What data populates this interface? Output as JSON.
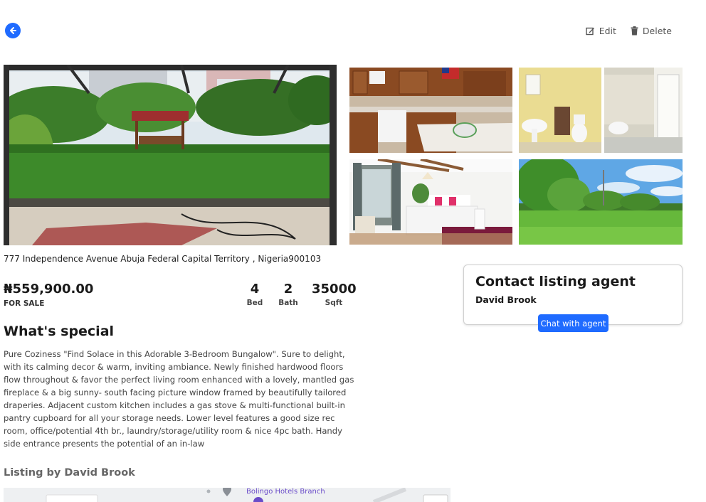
{
  "header": {
    "back_icon": "arrow-left-circle-icon",
    "edit_label": "Edit",
    "edit_icon": "edit-icon",
    "delete_label": "Delete",
    "delete_icon": "trash-icon"
  },
  "gallery": {
    "photos": [
      {
        "subject": "garden-lawn-gazebo"
      },
      {
        "subject": "kitchen"
      },
      {
        "subject": "bathroom"
      },
      {
        "subject": "bedroom"
      },
      {
        "subject": "park-lawn"
      }
    ]
  },
  "listing": {
    "address": "777 Independence Avenue Abuja Federal Capital Territory , Nigeria900103",
    "price": "₦559,900.00",
    "status": "FOR SALE",
    "beds_value": "4",
    "beds_label": "Bed",
    "baths_value": "2",
    "baths_label": "Bath",
    "sqft_value": "35000",
    "sqft_label": "Sqft",
    "special_title": "What's special",
    "description": "Pure Coziness \"Find Solace in this Adorable 3-Bedroom Bungalow\". Sure to delight, with its calming decor & warm, inviting ambiance. Newly finished hardwood floors flow throughout & favor the perfect living room enhanced with a lovely, mantled gas fireplace & a big sunny- south facing picture window framed by beautifully tailored draperies. Adjacent custom kitchen includes a gas stove & multi-functional built-in pantry cupboard for all your storage needs. Lower level features a good size rec room, office/potential 4th br., laundry/storage/utility room & nice 4pc bath. Handy side entrance presents the potential of an in-law",
    "listing_by": "Listing by David Brook"
  },
  "map": {
    "place_label": "Bolingo Hotels Branch"
  },
  "contact": {
    "title": "Contact listing agent",
    "agent_name": "David Brook",
    "chat_label": "Chat with agent"
  },
  "colors": {
    "accent": "#1f6bff"
  }
}
